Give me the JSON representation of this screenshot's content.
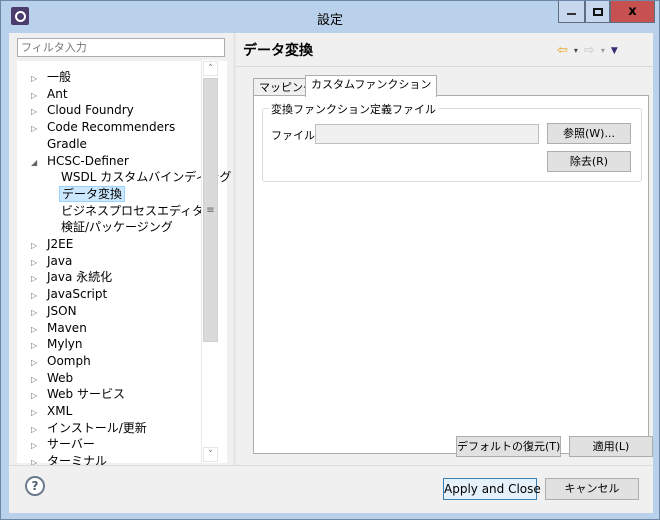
{
  "window": {
    "title": "設定",
    "icon": "eclipse-gear-icon",
    "controls": {
      "minimize": "minimize",
      "maximize": "maximize",
      "close": "x"
    }
  },
  "sidebar": {
    "filter_placeholder": "フィルタ入力",
    "items": [
      {
        "label": "一般",
        "expander": "▷",
        "level": 0
      },
      {
        "label": "Ant",
        "expander": "▷",
        "level": 0
      },
      {
        "label": "Cloud Foundry",
        "expander": "▷",
        "level": 0
      },
      {
        "label": "Code Recommenders",
        "expander": "▷",
        "level": 0
      },
      {
        "label": "Gradle",
        "expander": "",
        "level": 0
      },
      {
        "label": "HCSC-Definer",
        "expander": "◢",
        "level": 0
      },
      {
        "label": "WSDL カスタムバインディング",
        "expander": "",
        "level": 1
      },
      {
        "label": "データ変換",
        "expander": "",
        "level": 1,
        "selected": true
      },
      {
        "label": "ビジネスプロセスエディタ",
        "expander": "",
        "level": 1
      },
      {
        "label": "検証/パッケージング",
        "expander": "",
        "level": 1
      },
      {
        "label": "J2EE",
        "expander": "▷",
        "level": 0
      },
      {
        "label": "Java",
        "expander": "▷",
        "level": 0
      },
      {
        "label": "Java 永続化",
        "expander": "▷",
        "level": 0
      },
      {
        "label": "JavaScript",
        "expander": "▷",
        "level": 0
      },
      {
        "label": "JSON",
        "expander": "▷",
        "level": 0
      },
      {
        "label": "Maven",
        "expander": "▷",
        "level": 0
      },
      {
        "label": "Mylyn",
        "expander": "▷",
        "level": 0
      },
      {
        "label": "Oomph",
        "expander": "▷",
        "level": 0
      },
      {
        "label": "Web",
        "expander": "▷",
        "level": 0
      },
      {
        "label": "Web サービス",
        "expander": "▷",
        "level": 0
      },
      {
        "label": "XML",
        "expander": "▷",
        "level": 0
      },
      {
        "label": "インストール/更新",
        "expander": "▷",
        "level": 0
      },
      {
        "label": "サーバー",
        "expander": "▷",
        "level": 0
      },
      {
        "label": "ターミナル",
        "expander": "▷",
        "level": 0
      }
    ],
    "scrollbar": {
      "up": "˄",
      "down": "˅",
      "grip": "≡"
    }
  },
  "main": {
    "title": "データ変換",
    "nav": {
      "back": "⇦",
      "forward": "⇨",
      "dropdown": "▾",
      "menu": "▼"
    },
    "tabs": [
      {
        "label": "マッピング",
        "active": false
      },
      {
        "label": "カスタムファンクション",
        "active": true
      }
    ],
    "group": {
      "legend": "変換ファンクション定義ファイル",
      "file_label": "ファイル:",
      "file_value": "",
      "browse_button": "参照(W)...",
      "remove_button": "除去(R)"
    },
    "restore_defaults_button": "デフォルトの復元(T)",
    "apply_button": "適用(L)"
  },
  "footer": {
    "help": "?",
    "apply_close_button": "Apply and Close",
    "cancel_button": "キャンセル"
  }
}
